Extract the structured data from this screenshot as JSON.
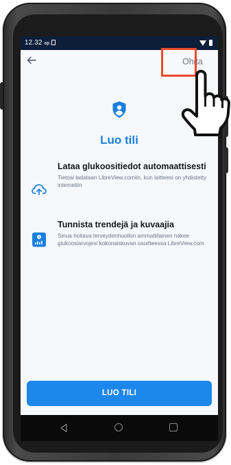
{
  "status_bar": {
    "time": "12.32",
    "period": "ap."
  },
  "header": {
    "back_icon": "arrow-left-icon",
    "skip_label": "Ohita",
    "logo_icon": "shield-user-icon"
  },
  "title": "Luo tili",
  "features": [
    {
      "icon": "cloud-upload-icon",
      "title": "Lataa glukoositiedot automaattisesti",
      "description": "Tietosi ladataan LibreView.comiin, kun laitteesi on yhdistetty internetiin"
    },
    {
      "icon": "chart-report-icon",
      "title": "Tunnista trendejä ja kuvaajia",
      "description": "Sinua hoitava terveydenhuollon ammattilainen näkee glukoosiarvojesi kokonaiskuvan osoitteessa LibreView.com"
    }
  ],
  "primary_button": "LUO TILI",
  "colors": {
    "accent": "#1a7fe0",
    "button": "#1e87ec",
    "highlight": "#e84b2b",
    "status_bar": "#0b1e3a"
  },
  "overlay": {
    "pointer_icon": "pointing-hand-icon"
  }
}
